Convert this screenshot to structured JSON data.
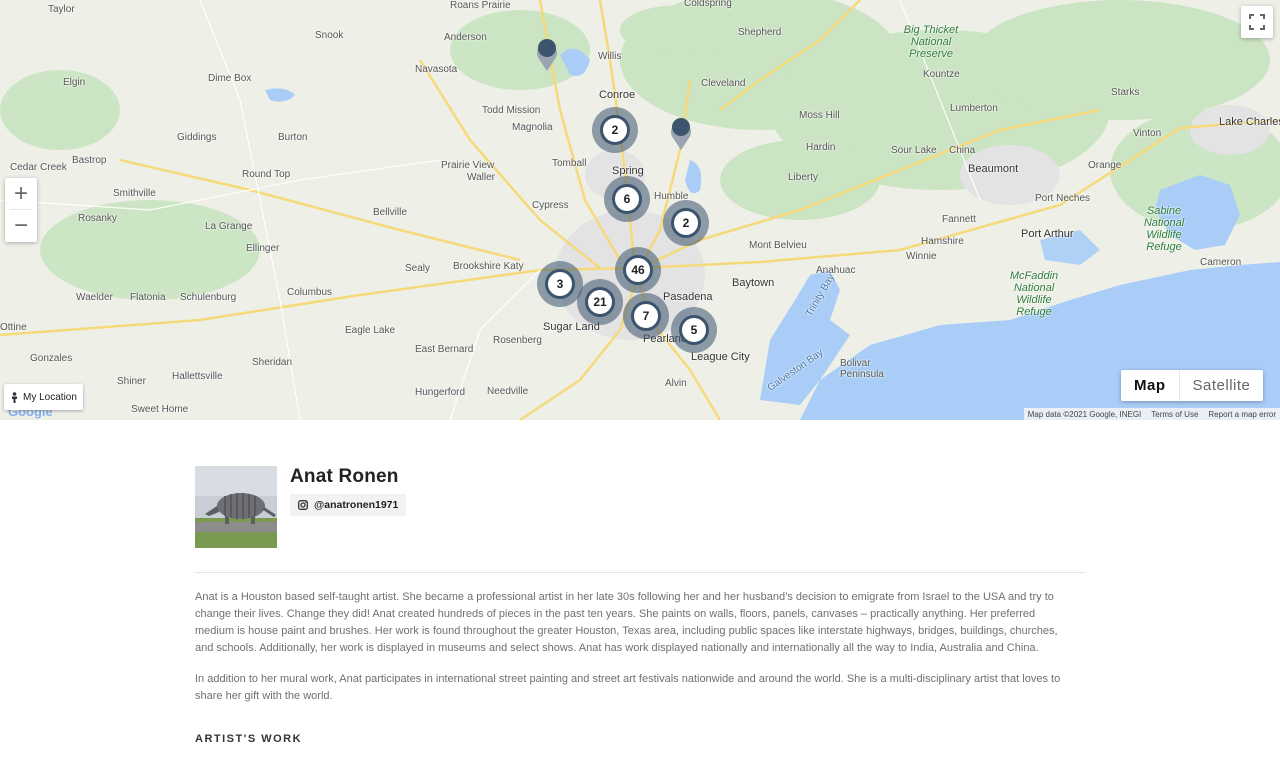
{
  "map": {
    "places": [
      {
        "name": "Taylor",
        "cls": ""
      },
      {
        "name": "Roans Prairie",
        "cls": ""
      },
      {
        "name": "Coldspring",
        "cls": ""
      },
      {
        "name": "Shepherd",
        "cls": ""
      },
      {
        "name": "Snook",
        "cls": ""
      },
      {
        "name": "Anderson",
        "cls": ""
      },
      {
        "name": "Willis",
        "cls": ""
      },
      {
        "name": "Dime Box",
        "cls": ""
      },
      {
        "name": "Navasota",
        "cls": ""
      },
      {
        "name": "Conroe",
        "cls": "city"
      },
      {
        "name": "Cleveland",
        "cls": ""
      },
      {
        "name": "Kountze",
        "cls": ""
      },
      {
        "name": "Elgin",
        "cls": ""
      },
      {
        "name": "Todd Mission",
        "cls": ""
      },
      {
        "name": "Lumberton",
        "cls": ""
      },
      {
        "name": "Starks",
        "cls": ""
      },
      {
        "name": "Magnolia",
        "cls": ""
      },
      {
        "name": "Moss Hill",
        "cls": ""
      },
      {
        "name": "Giddings",
        "cls": ""
      },
      {
        "name": "Burton",
        "cls": ""
      },
      {
        "name": "Hardin",
        "cls": ""
      },
      {
        "name": "Vinton",
        "cls": ""
      },
      {
        "name": "Lake Charles",
        "cls": "city"
      },
      {
        "name": "Bastrop",
        "cls": ""
      },
      {
        "name": "Tomball",
        "cls": ""
      },
      {
        "name": "Sour Lake",
        "cls": ""
      },
      {
        "name": "China",
        "cls": ""
      },
      {
        "name": "Cedar Creek",
        "cls": ""
      },
      {
        "name": "Prairie View",
        "cls": ""
      },
      {
        "name": "Spring",
        "cls": "city"
      },
      {
        "name": "Beaumont",
        "cls": "city"
      },
      {
        "name": "Orange",
        "cls": ""
      },
      {
        "name": "Round Top",
        "cls": ""
      },
      {
        "name": "Waller",
        "cls": ""
      },
      {
        "name": "Humble",
        "cls": ""
      },
      {
        "name": "Liberty",
        "cls": ""
      },
      {
        "name": "Smithville",
        "cls": ""
      },
      {
        "name": "Cypress",
        "cls": ""
      },
      {
        "name": "Port Neches",
        "cls": ""
      },
      {
        "name": "Rosanky",
        "cls": ""
      },
      {
        "name": "Bellville",
        "cls": ""
      },
      {
        "name": "Fannett",
        "cls": ""
      },
      {
        "name": "La Grange",
        "cls": ""
      },
      {
        "name": "Port Arthur",
        "cls": "city"
      },
      {
        "name": "Mont Belvieu",
        "cls": ""
      },
      {
        "name": "Hamshire",
        "cls": ""
      },
      {
        "name": "Ellinger",
        "cls": ""
      },
      {
        "name": "Winnie",
        "cls": ""
      },
      {
        "name": "Sealy",
        "cls": ""
      },
      {
        "name": "Brookshire Katy",
        "cls": ""
      },
      {
        "name": "Anahuac",
        "cls": ""
      },
      {
        "name": "Cameron",
        "cls": ""
      },
      {
        "name": "Columbus",
        "cls": ""
      },
      {
        "name": "Baytown",
        "cls": "city"
      },
      {
        "name": "Waelder",
        "cls": ""
      },
      {
        "name": "Flatonia",
        "cls": ""
      },
      {
        "name": "Schulenburg",
        "cls": ""
      },
      {
        "name": "Pasadena",
        "cls": "city"
      },
      {
        "name": "Ottine",
        "cls": ""
      },
      {
        "name": "Eagle Lake",
        "cls": ""
      },
      {
        "name": "Sugar Land",
        "cls": "city"
      },
      {
        "name": "Pearland",
        "cls": "city"
      },
      {
        "name": "East Bernard",
        "cls": ""
      },
      {
        "name": "Rosenberg",
        "cls": ""
      },
      {
        "name": "Gonzales",
        "cls": ""
      },
      {
        "name": "Sheridan",
        "cls": ""
      },
      {
        "name": "League City",
        "cls": "city"
      },
      {
        "name": "Bolivar Peninsula",
        "cls": ""
      },
      {
        "name": "Shiner",
        "cls": ""
      },
      {
        "name": "Hallettsville",
        "cls": ""
      },
      {
        "name": "Alvin",
        "cls": ""
      },
      {
        "name": "Hungerford",
        "cls": ""
      },
      {
        "name": "Needville",
        "cls": ""
      },
      {
        "name": "Sweet Home",
        "cls": ""
      },
      {
        "name": "Trinity Bay",
        "cls": ""
      },
      {
        "name": "Galveston Bay",
        "cls": ""
      }
    ],
    "parks": [
      {
        "name": "Big Thicket National Preserve"
      },
      {
        "name": "Sabine National Wildlife Refuge"
      },
      {
        "name": "McFaddin National Wildlife Refuge"
      }
    ],
    "clusters": [
      {
        "count": "2"
      },
      {
        "count": "6"
      },
      {
        "count": "2"
      },
      {
        "count": "46"
      },
      {
        "count": "3"
      },
      {
        "count": "21"
      },
      {
        "count": "7"
      },
      {
        "count": "5"
      }
    ],
    "controls": {
      "zoom_in": "+",
      "zoom_out": "−",
      "map_label": "Map",
      "satellite_label": "Satellite",
      "my_location": "My Location",
      "google_logo": "Google"
    },
    "attribution": {
      "data": "Map data ©2021 Google, INEGI",
      "terms": "Terms of Use",
      "report": "Report a map error"
    },
    "colors": {
      "land": "#eef0e8",
      "water": "#a9cdf7",
      "forest": "#c8e3c0",
      "urban": "#e3e3e3",
      "highway": "#f6d97a",
      "marker": "#3c546e"
    }
  },
  "profile": {
    "name": "Anat Ronen",
    "instagram_icon": "instagram-icon",
    "handle": "@anatronen1971",
    "bio": [
      "Anat is a Houston based self-taught artist. She became a professional artist in her late 30s following her and her husband’s decision to emigrate from Israel to the USA and try to change their lives. Change they did! Anat created hundreds of pieces in the past ten years. She paints on walls, floors, panels, canvases – practically anything. Her preferred medium is house paint and brushes. Her work is found throughout the greater Houston, Texas area, including public spaces like interstate highways, bridges, buildings, churches, and schools. Additionally, her work is displayed in museums and select shows. Anat has work displayed nationally and internationally all the way to India, Australia and China.",
      "In addition to her mural work, Anat participates in international street painting and street art festivals nationwide and around the world. She is a multi-disciplinary artist that loves to share her gift with the world."
    ],
    "section_title": "ARTIST'S WORK"
  }
}
